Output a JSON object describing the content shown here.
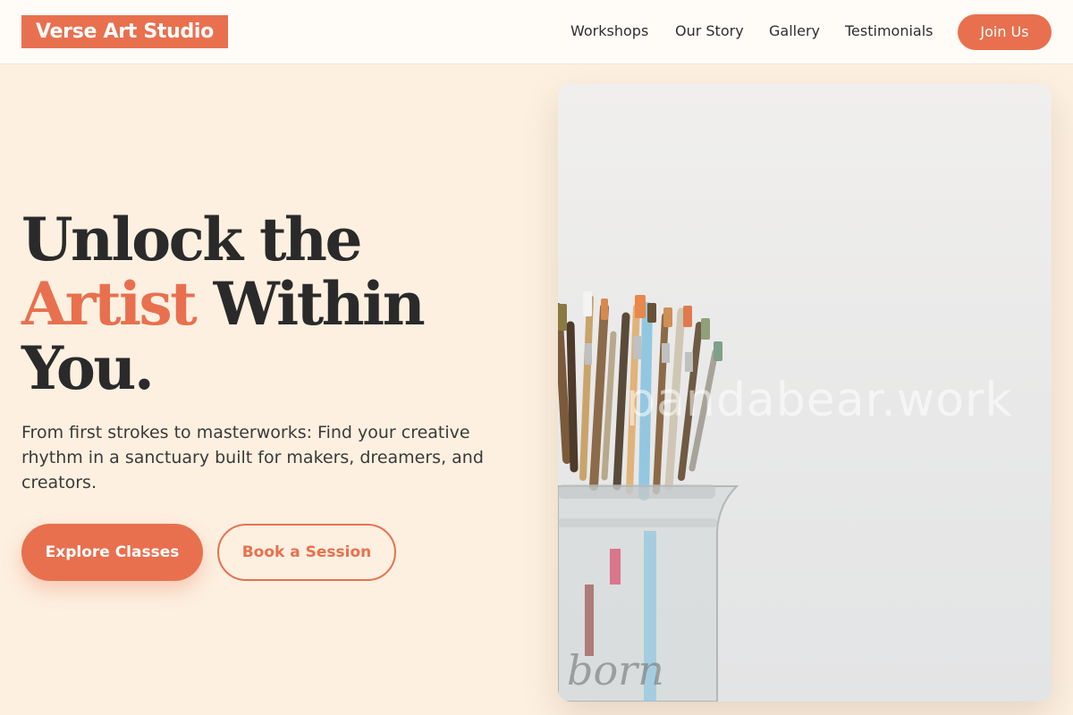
{
  "header": {
    "logo": "Verse Art Studio",
    "nav": [
      "Workshops",
      "Our Story",
      "Gallery",
      "Testimonials"
    ],
    "cta": "Join Us"
  },
  "hero": {
    "title_line1": "Unlock the",
    "title_accent": "Artist",
    "title_line2_rest": " Within",
    "title_line3": "You.",
    "subtitle": "From first strokes to masterworks: Find your creative rhythm in a sanctuary built for makers, dreamers, and creators.",
    "primary_button": "Explore Classes",
    "secondary_button": "Book a Session",
    "image_watermark": "pandabear.work"
  },
  "colors": {
    "accent": "#e8704f",
    "background": "#fdf0e0",
    "header_bg": "#fffcf8",
    "text": "#2a2a2a"
  }
}
